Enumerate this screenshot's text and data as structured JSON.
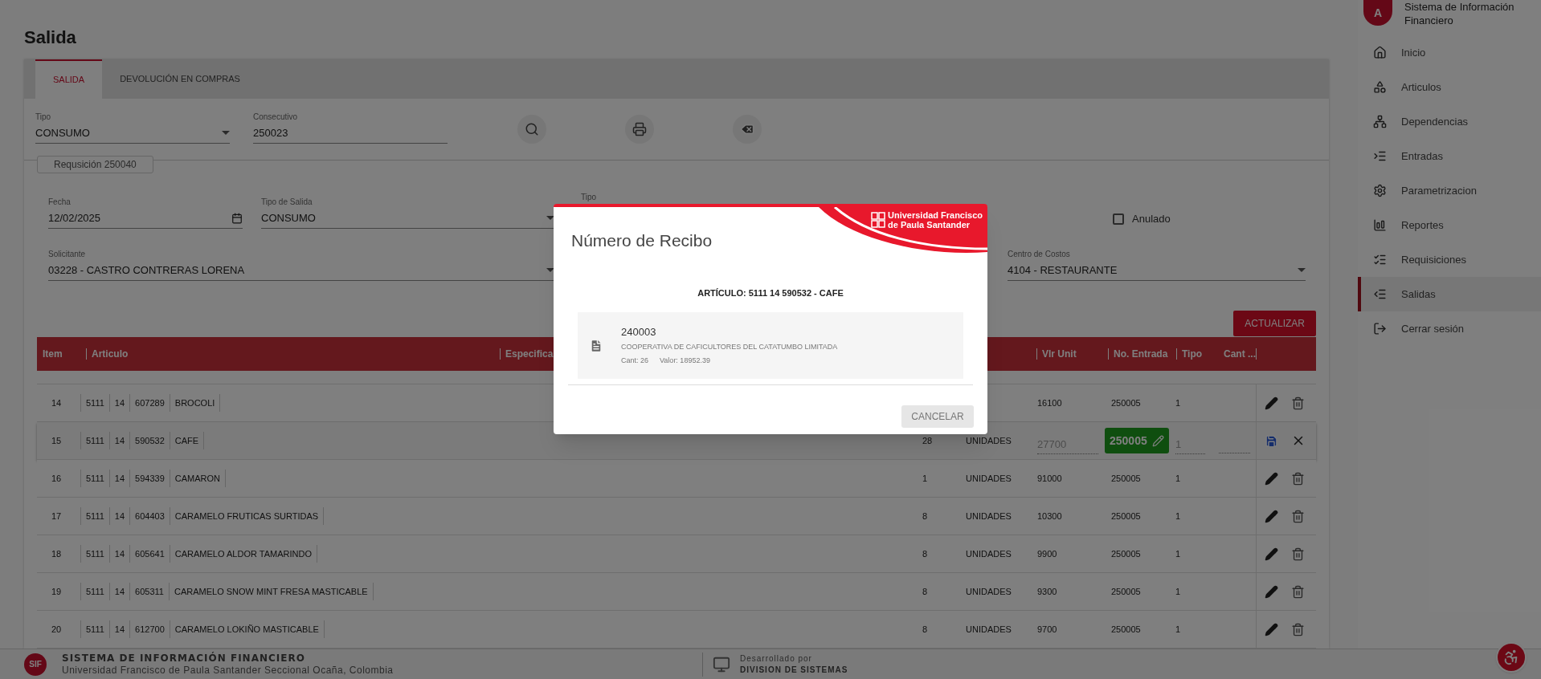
{
  "page": {
    "title": "Salida"
  },
  "tabs": [
    {
      "label": "SALIDA",
      "selected": true
    },
    {
      "label": "DEVOLUCIÓN EN COMPRAS",
      "selected": false
    }
  ],
  "search_form": {
    "fields": [
      {
        "label": "Tipo",
        "value": "CONSUMO",
        "kind": "select"
      },
      {
        "label": "Consecutivo",
        "value": "250023",
        "kind": "text"
      }
    ]
  },
  "requisition": {
    "legend": "Requsición 250040",
    "fields": [
      {
        "label": "Fecha",
        "value": "12/02/2025",
        "kind": "date"
      },
      {
        "label": "Tipo de Salida",
        "value": "CONSUMO",
        "kind": "select"
      },
      {
        "label": "Tipo"
      },
      {
        "label": "Solicitante",
        "value": "03228 - CASTRO CONTRERAS LORENA",
        "kind": "select"
      },
      {
        "label": "Centro de Costos",
        "value": "4104 - RESTAURANTE",
        "kind": "select"
      }
    ],
    "anulado": {
      "label": "Anulado",
      "checked": false
    }
  },
  "update_button": "ACTUALIZAR",
  "table": {
    "columns": [
      "Item",
      "Articulo",
      "Especifica",
      "Vlr Unit",
      "No. Entrada",
      "Tipo",
      "Cant ..."
    ],
    "rows": [
      {
        "item": "14",
        "codes": [
          "5111",
          "14",
          "607289"
        ],
        "name": "BROCOLI",
        "vlr_unit": "16100",
        "entrada": "250005",
        "tipo": "1",
        "editing": false
      },
      {
        "item": "15",
        "codes": [
          "5111",
          "14",
          "590532"
        ],
        "name": "CAFE",
        "cantidad": "28",
        "unidad": "UNIDADES",
        "vlr_unit": "27700",
        "entrada": "250005",
        "tipo": "1",
        "editing": true
      },
      {
        "item": "16",
        "codes": [
          "5111",
          "14",
          "594339"
        ],
        "name": "CAMARON",
        "cantidad": "1",
        "unidad": "UNIDADES",
        "vlr_unit": "91000",
        "entrada": "250005",
        "tipo": "1",
        "editing": false
      },
      {
        "item": "17",
        "codes": [
          "5111",
          "14",
          "604403"
        ],
        "name": "CARAMELO FRUTICAS SURTIDAS",
        "cantidad": "8",
        "unidad": "UNIDADES",
        "vlr_unit": "10300",
        "entrada": "250005",
        "tipo": "1",
        "editing": false
      },
      {
        "item": "18",
        "codes": [
          "5111",
          "14",
          "605641"
        ],
        "name": "CARAMELO ALDOR TAMARINDO",
        "cantidad": "8",
        "unidad": "UNIDADES",
        "vlr_unit": "9900",
        "entrada": "250005",
        "tipo": "1",
        "editing": false
      },
      {
        "item": "19",
        "codes": [
          "5111",
          "14",
          "605311"
        ],
        "name": "CARAMELO SNOW MINT FRESA MASTICABLE",
        "cantidad": "8",
        "unidad": "UNIDADES",
        "vlr_unit": "9300",
        "entrada": "250005",
        "tipo": "1",
        "editing": false
      },
      {
        "item": "20",
        "codes": [
          "5111",
          "14",
          "612700"
        ],
        "name": "CARAMELO LOKIÑO MASTICABLE",
        "cantidad": "8",
        "unidad": "UNIDADES",
        "vlr_unit": "9700",
        "entrada": "250005",
        "tipo": "1",
        "editing": false
      }
    ]
  },
  "modal": {
    "title": "Número de Recibo",
    "logo_lines": [
      "Universidad Francisco",
      "de Paula Santander"
    ],
    "article": "ARTÍCULO: 5111 14 590532 - CAFE",
    "receipts": [
      {
        "number": "240003",
        "supplier": "COOPERATIVA DE CAFICULTORES DEL CATATUMBO LIMITADA",
        "cant": "Cant: 26",
        "valor": "Valor: 18952.39"
      }
    ],
    "cancel_button": "CANCELAR"
  },
  "sidebar": {
    "avatar": "A",
    "title": "Sistema de Información Financiero",
    "items": [
      {
        "label": "Inicio",
        "selected": false
      },
      {
        "label": "Articulos",
        "selected": false
      },
      {
        "label": "Dependencias",
        "selected": false
      },
      {
        "label": "Entradas",
        "selected": false
      },
      {
        "label": "Parametrizacion",
        "selected": false
      },
      {
        "label": "Reportes",
        "selected": false
      },
      {
        "label": "Requisiciones",
        "selected": false
      },
      {
        "label": "Salidas",
        "selected": true
      },
      {
        "label": "Cerrar sesión",
        "selected": false
      }
    ]
  },
  "footer": {
    "logo": "SIF",
    "title": "SISTEMA DE INFORMACIÓN FINANCIERO",
    "subtitle": "Universidad Francisco de Paula Santander Seccional Ocaña, Colombia",
    "credit_label": "Desarrollado por",
    "credit": "DIVISION DE SISTEMAS"
  }
}
